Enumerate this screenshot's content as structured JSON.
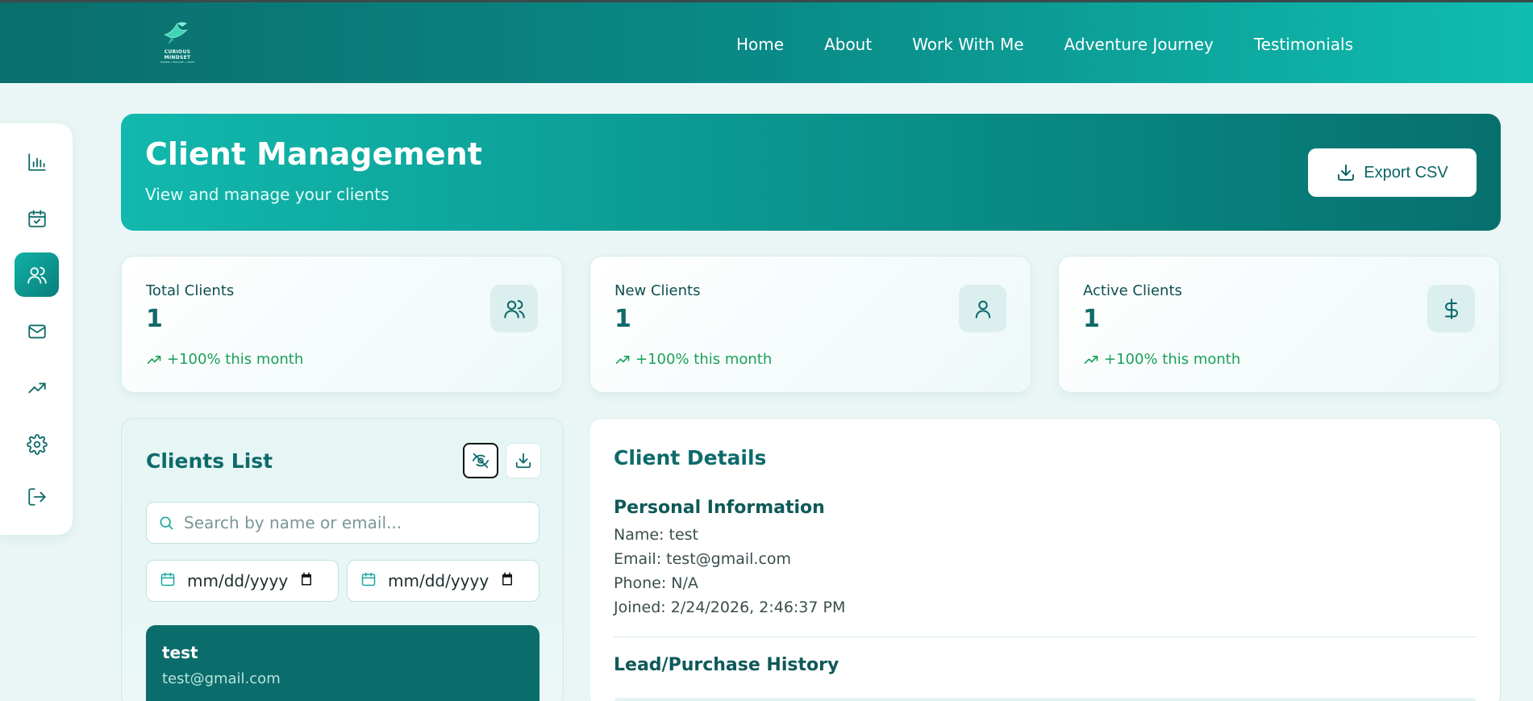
{
  "logo": {
    "text": "CURIOUS MINDSET",
    "tagline": "INSPIRE • EXPLORE • GROW"
  },
  "nav": {
    "items": [
      {
        "label": "Home"
      },
      {
        "label": "About"
      },
      {
        "label": "Work With Me"
      },
      {
        "label": "Adventure Journey"
      },
      {
        "label": "Testimonials"
      }
    ]
  },
  "sidebar": {
    "items": [
      {
        "icon": "bar-chart-icon"
      },
      {
        "icon": "calendar-check-icon"
      },
      {
        "icon": "users-icon",
        "active": true
      },
      {
        "icon": "mail-icon"
      },
      {
        "icon": "trending-up-icon"
      },
      {
        "icon": "gear-icon"
      },
      {
        "icon": "logout-icon"
      }
    ]
  },
  "hero": {
    "title": "Client Management",
    "subtitle": "View and manage your clients",
    "export_label": "Export CSV"
  },
  "stats": [
    {
      "label": "Total Clients",
      "value": "1",
      "trend": "+100% this month",
      "icon": "users-icon"
    },
    {
      "label": "New Clients",
      "value": "1",
      "trend": "+100% this month",
      "icon": "user-icon"
    },
    {
      "label": "Active Clients",
      "value": "1",
      "trend": "+100% this month",
      "icon": "dollar-icon"
    }
  ],
  "clients_list": {
    "title": "Clients List",
    "search_placeholder": "Search by name or email...",
    "date_from": "mm/dd/yyyy",
    "date_to": "mm/dd/yyyy",
    "items": [
      {
        "name": "test",
        "email": "test@gmail.com"
      }
    ]
  },
  "client_details": {
    "title": "Client Details",
    "personal_heading": "Personal Information",
    "name": "Name: test",
    "email": "Email: test@gmail.com",
    "phone": "Phone: N/A",
    "joined": "Joined: 2/24/2026, 2:46:37 PM",
    "history_heading": "Lead/Purchase History"
  },
  "colors": {
    "primary": "#0a7e7b",
    "accent": "#12b8ad",
    "trend_green": "#1aa05b",
    "background": "#eaf6f6"
  }
}
